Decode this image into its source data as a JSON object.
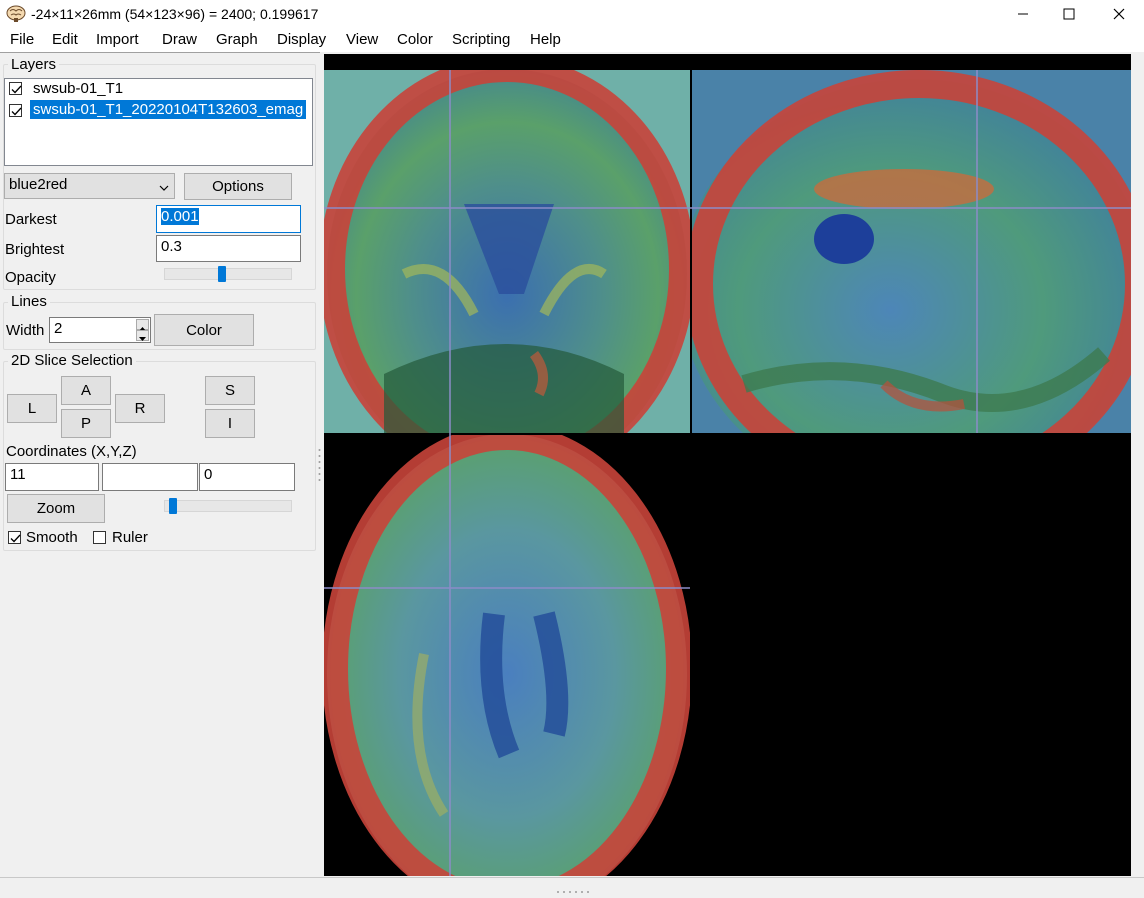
{
  "window": {
    "title": "-24×11×26mm (54×123×96) =  2400;  0.199617",
    "icon": "brain-icon",
    "controls": [
      "minimize-icon",
      "maximize-icon",
      "close-icon"
    ]
  },
  "menu": [
    "File",
    "Edit",
    "Import",
    "Draw",
    "Graph",
    "Display",
    "View",
    "Color",
    "Scripting",
    "Help"
  ],
  "layers": {
    "title": "Layers",
    "items": [
      {
        "label": "swsub-01_T1",
        "checked": true,
        "selected": false
      },
      {
        "label": "swsub-01_T1_20220104T132603_emag",
        "checked": true,
        "selected": true
      }
    ],
    "colormap": "blue2red",
    "options_label": "Options",
    "darkest_label": "Darkest",
    "darkest_value": "0.001",
    "brightest_label": "Brightest",
    "brightest_value": "0.3",
    "opacity_label": "Opacity",
    "opacity_fraction": 0.45
  },
  "lines": {
    "title": "Lines",
    "width_label": "Width",
    "width_value": "2",
    "color_label": "Color"
  },
  "slice": {
    "title": "2D Slice Selection",
    "buttons": {
      "L": "L",
      "A": "A",
      "P": "P",
      "R": "R",
      "S": "S",
      "I": "I"
    },
    "coords_label": "Coordinates (X,Y,Z)",
    "x": "11",
    "y": "",
    "z": "0",
    "zoom_label": "Zoom",
    "zoom_fraction": 0.04,
    "smooth_label": "Smooth",
    "smooth_checked": true,
    "ruler_label": "Ruler",
    "ruler_checked": false
  },
  "colors": {
    "selection": "#0078d7",
    "crosshair": "#8c8cc8",
    "viewer_bg": "#000000"
  }
}
